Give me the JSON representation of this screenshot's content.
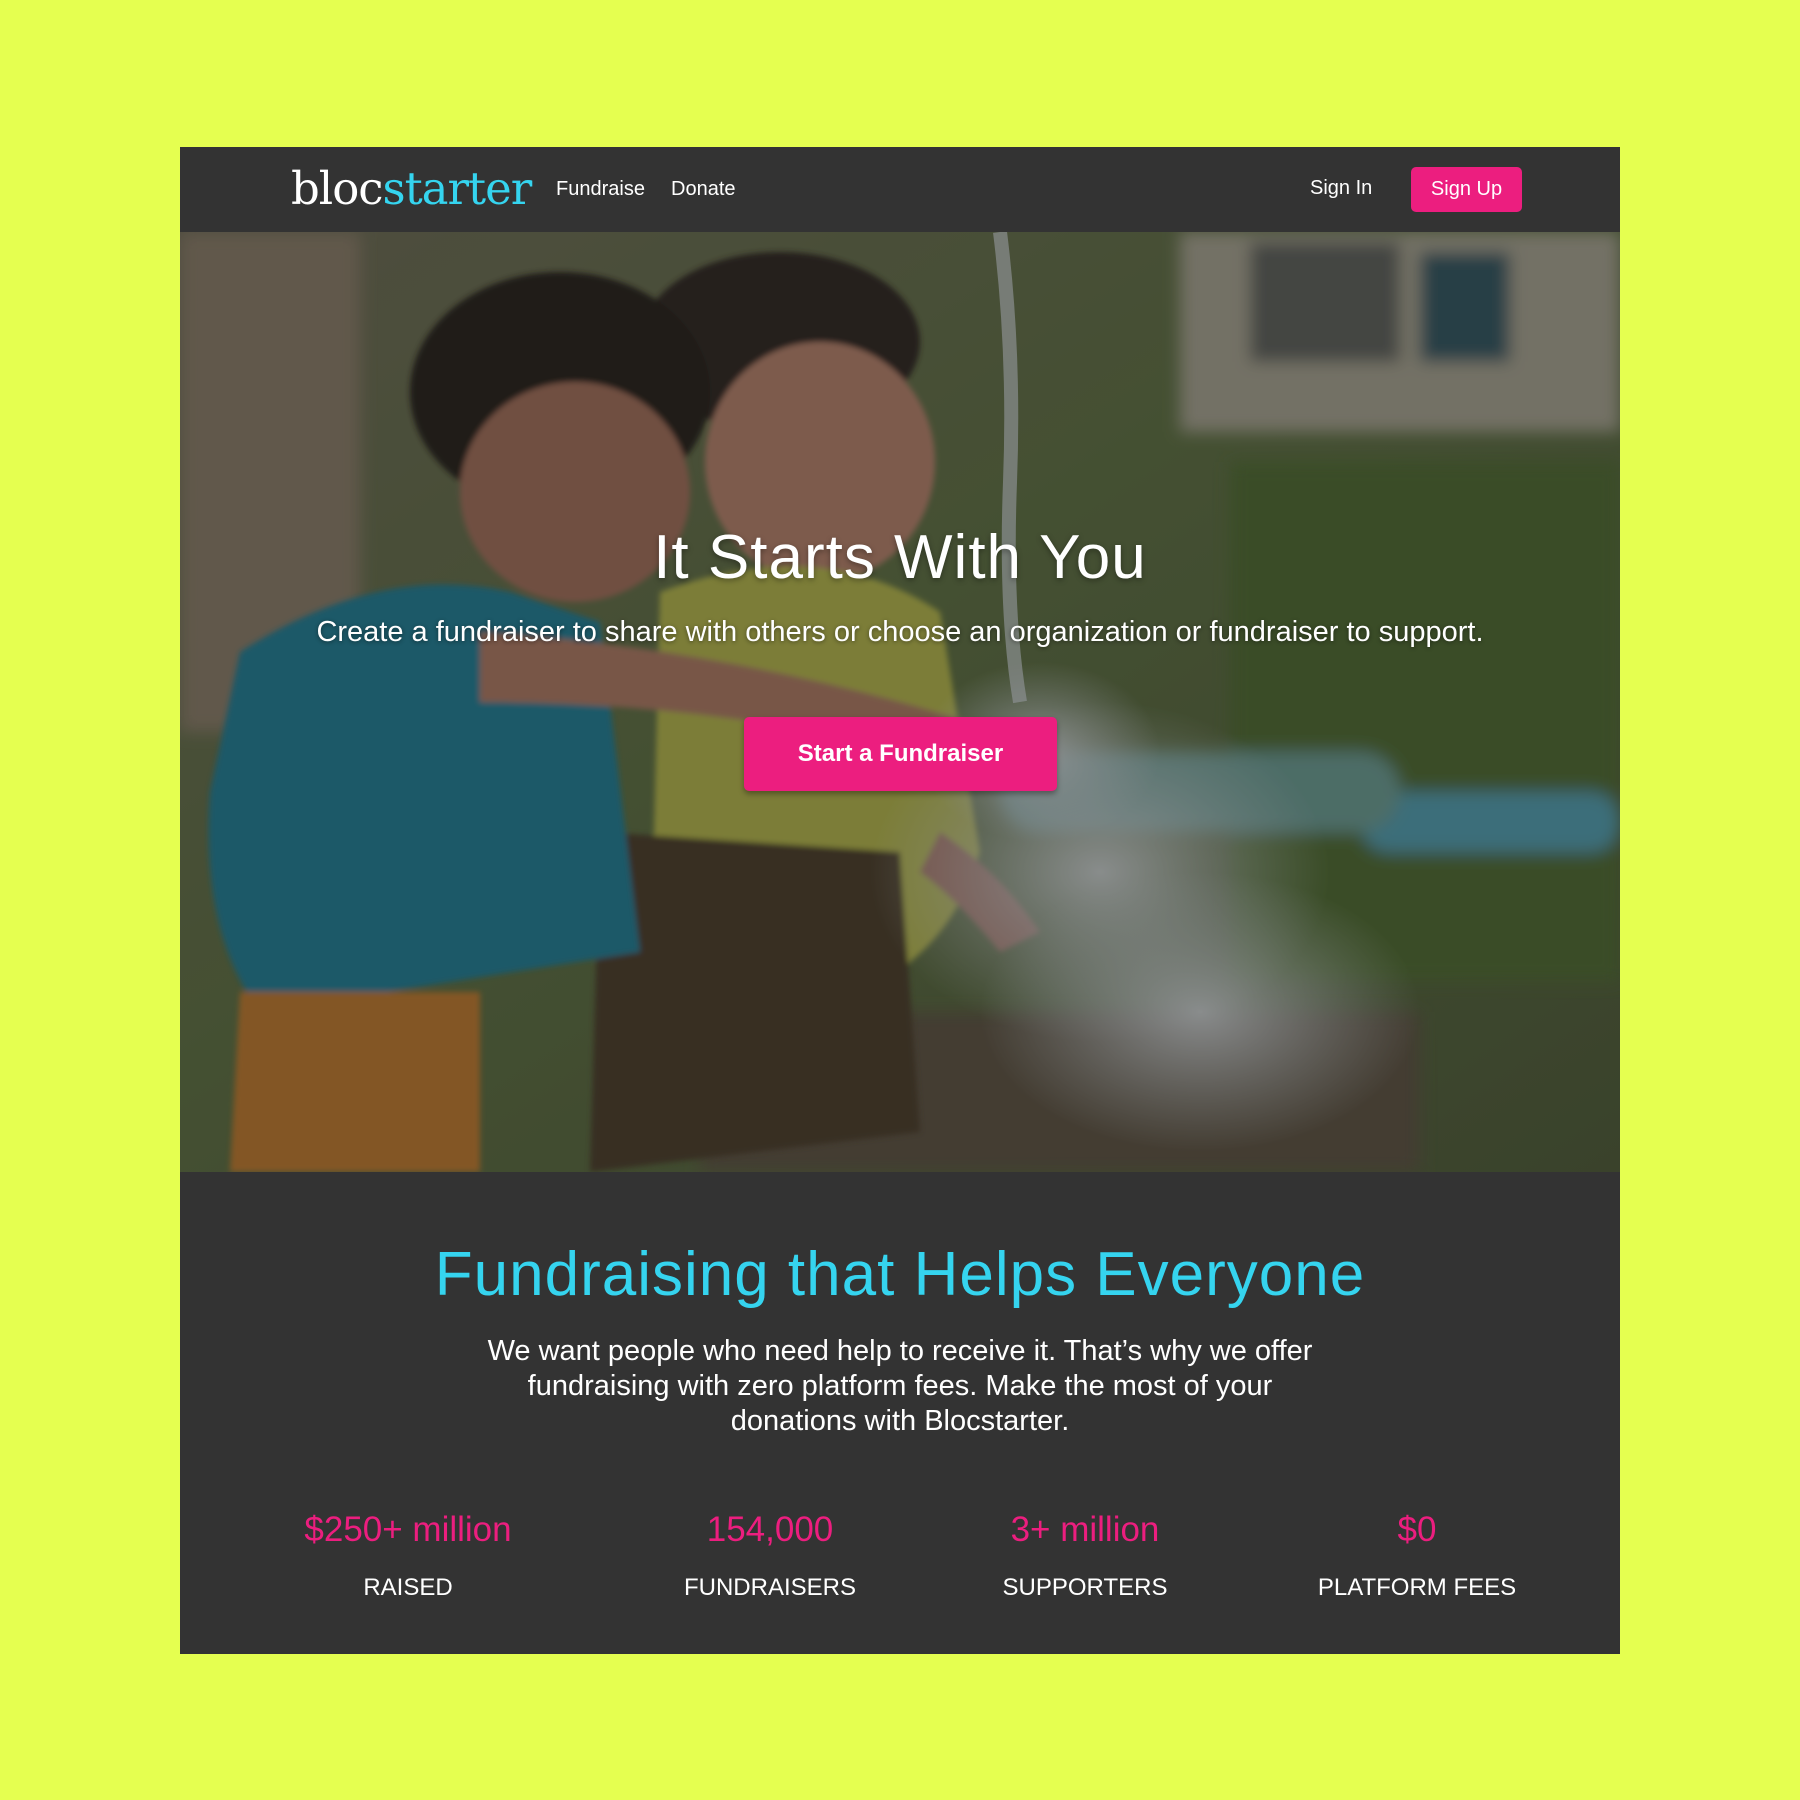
{
  "nav": {
    "logo_part1": "bloc",
    "logo_part2": "starter",
    "links": [
      "Fundraise",
      "Donate"
    ],
    "sign_in": "Sign In",
    "sign_up": "Sign Up"
  },
  "hero": {
    "title": "It Starts With You",
    "subtitle": "Create a fundraiser to share with others or choose an organization or fundraiser to support.",
    "cta": "Start a Fundraiser"
  },
  "info": {
    "title": "Fundraising that Helps Everyone",
    "text": "We want people who need help to receive it. That’s why we offer fundraising with zero platform fees. Make the most of your donations with Blocstarter."
  },
  "stats": [
    {
      "value": "$250+ million",
      "label": "RAISED"
    },
    {
      "value": "154,000",
      "label": "FUNDRAISERS"
    },
    {
      "value": "3+ million",
      "label": "SUPPORTERS"
    },
    {
      "value": "$0",
      "label": "PLATFORM FEES"
    }
  ],
  "colors": {
    "page_background": "#e5ff50",
    "panel": "#333333",
    "accent_pink": "#ec1e7f",
    "accent_cyan": "#35d4ef",
    "text": "#ffffff"
  }
}
